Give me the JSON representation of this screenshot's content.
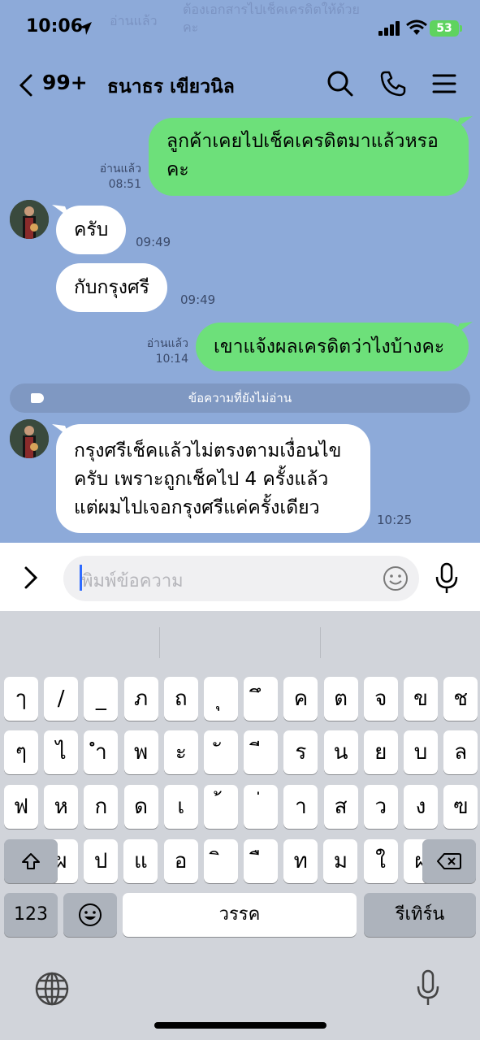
{
  "status": {
    "time": "10:06",
    "battery": "53"
  },
  "header": {
    "unread_count": "99+",
    "name": "ธนาธร เขียวนิล"
  },
  "messages": [
    {
      "side": "me",
      "text": "ลูกค้าเคยไปเช็คเครดิตมาแล้วหรอ\nคะ",
      "read": "อ่านแล้ว",
      "time": "08:51"
    },
    {
      "side": "them",
      "text": "ครับ",
      "time": "09:49"
    },
    {
      "side": "them",
      "text": "กับกรุงศรี",
      "time": "09:49"
    },
    {
      "side": "me",
      "text": "เขาแจ้งผลเครดิตว่าไงบ้างคะ",
      "read": "อ่านแล้ว",
      "time": "10:14"
    },
    {
      "side": "them",
      "text": "กรุงศรีเช็คแล้วไม่ตรงตามเงื่อนไข\nครับ เพราะถูกเช็คไป 4 ครั้งแล้ว\nแต่ผมไปเจอกรุงศรีแค่ครั้งเดียว",
      "time": "10:25"
    }
  ],
  "unread_divider": "ข้อความที่ยังไม่อ่าน",
  "input": {
    "placeholder": "พิมพ์ข้อความ"
  },
  "keyboard": {
    "row1": [
      "ๅ",
      "/",
      "_",
      "ภ",
      "ถ",
      "ุ",
      "ึ",
      "ค",
      "ต",
      "จ",
      "ข",
      "ช"
    ],
    "row2": [
      "ๆ",
      "ไ",
      "ำ",
      "พ",
      "ะ",
      "ั",
      "ี",
      "ร",
      "น",
      "ย",
      "บ",
      "ล"
    ],
    "row3": [
      "ฟ",
      "ห",
      "ก",
      "ด",
      "เ",
      "้",
      "่",
      "า",
      "ส",
      "ว",
      "ง",
      "ฃ"
    ],
    "row4": [
      "ผ",
      "ป",
      "แ",
      "อ",
      "ิ",
      "ื",
      "ท",
      "ม",
      "ใ",
      "ฝ"
    ],
    "numbers_label": "123",
    "space_label": "วรรค",
    "return_label": "รีเทิร์น"
  },
  "colors": {
    "chat_bg": "#8daad9",
    "my_bubble": "#6de07a",
    "their_bubble": "#ffffff"
  }
}
